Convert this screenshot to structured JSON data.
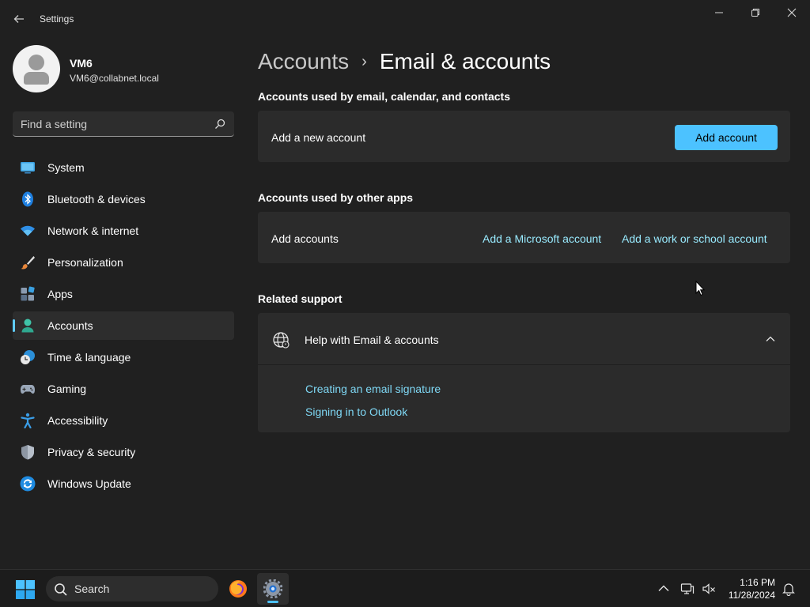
{
  "window": {
    "app_title": "Settings"
  },
  "profile": {
    "name": "VM6",
    "email": "VM6@collabnet.local"
  },
  "search": {
    "placeholder": "Find a setting"
  },
  "sidebar": {
    "items": [
      {
        "label": "System",
        "icon": "monitor-icon"
      },
      {
        "label": "Bluetooth & devices",
        "icon": "bluetooth-icon"
      },
      {
        "label": "Network & internet",
        "icon": "wifi-icon"
      },
      {
        "label": "Personalization",
        "icon": "brush-icon"
      },
      {
        "label": "Apps",
        "icon": "apps-icon"
      },
      {
        "label": "Accounts",
        "icon": "person-icon",
        "active": true
      },
      {
        "label": "Time & language",
        "icon": "clock-globe-icon"
      },
      {
        "label": "Gaming",
        "icon": "gamepad-icon"
      },
      {
        "label": "Accessibility",
        "icon": "accessibility-icon"
      },
      {
        "label": "Privacy & security",
        "icon": "shield-icon"
      },
      {
        "label": "Windows Update",
        "icon": "update-icon"
      }
    ]
  },
  "breadcrumb": {
    "parent": "Accounts",
    "separator": "›",
    "current": "Email & accounts"
  },
  "main": {
    "email_section_title": "Accounts used by email, calendar, and contacts",
    "add_new_account_label": "Add a new account",
    "add_account_button": "Add account",
    "other_apps_section_title": "Accounts used by other apps",
    "add_accounts_label": "Add accounts",
    "add_microsoft_account_link": "Add a Microsoft account",
    "add_work_school_link": "Add a work or school account",
    "related_support_title": "Related support",
    "help_title": "Help with Email & accounts",
    "help_links": [
      "Creating an email signature",
      "Signing in to Outlook"
    ]
  },
  "taskbar": {
    "search_label": "Search",
    "time": "1:16 PM",
    "date": "11/28/2024"
  },
  "colors": {
    "background": "#202020",
    "card": "#2b2b2b",
    "accent": "#4cc2ff",
    "link": "#99ebff"
  }
}
